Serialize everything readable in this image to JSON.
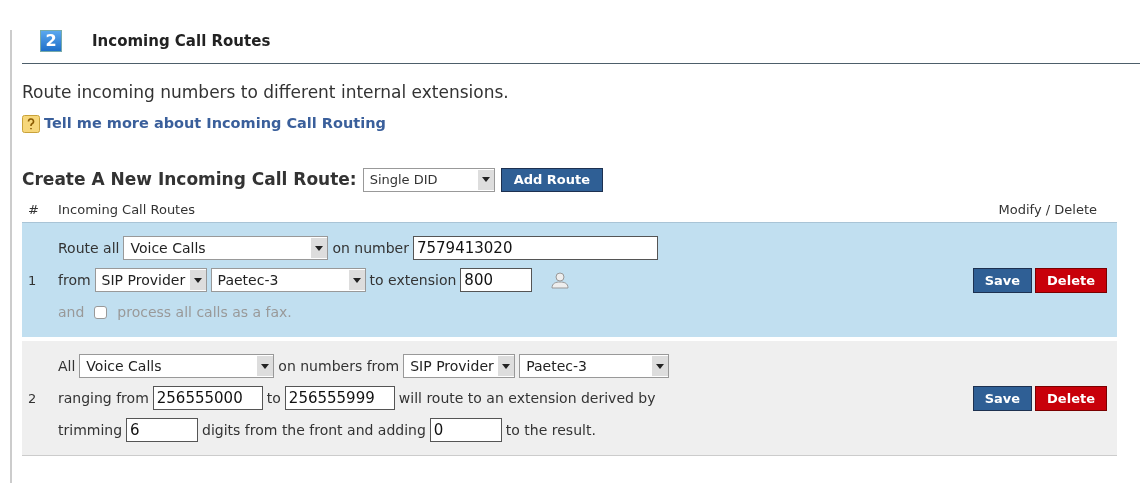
{
  "section": {
    "step": "2",
    "title": "Incoming Call Routes"
  },
  "description": "Route incoming numbers to different internal extensions.",
  "help_link": "Tell me more about Incoming Call Routing",
  "create": {
    "label": "Create A New Incoming Call Route:",
    "type_select": "Single DID",
    "button": "Add Route"
  },
  "table": {
    "columns": [
      "#",
      "Incoming Call Routes",
      "Modify / Delete"
    ],
    "rows": [
      {
        "number": "1",
        "selected": true,
        "lines": [
          {
            "disabled": false,
            "parts": [
              {
                "kind": "text",
                "text": "Route all"
              },
              {
                "kind": "select",
                "value": "Voice Calls"
              },
              {
                "kind": "text",
                "text": "on number"
              },
              {
                "kind": "input",
                "value": "7579413020"
              }
            ]
          },
          {
            "disabled": false,
            "parts": [
              {
                "kind": "text",
                "text": "from"
              },
              {
                "kind": "select",
                "value": "SIP Provider"
              },
              {
                "kind": "select",
                "value": "Paetec-3"
              },
              {
                "kind": "text",
                "text": "to extension"
              },
              {
                "kind": "input",
                "value": "800"
              },
              {
                "kind": "contact"
              }
            ]
          },
          {
            "disabled": true,
            "parts": [
              {
                "kind": "text",
                "text": "and"
              },
              {
                "kind": "checkbox",
                "checked": false
              },
              {
                "kind": "text",
                "text": "process all calls as a fax."
              }
            ]
          }
        ],
        "actions": [
          "Save",
          "Delete"
        ]
      },
      {
        "number": "2",
        "selected": false,
        "lines": [
          {
            "disabled": false,
            "parts": [
              {
                "kind": "text",
                "text": "All"
              },
              {
                "kind": "select",
                "value": "Voice Calls"
              },
              {
                "kind": "text",
                "text": "on numbers from"
              },
              {
                "kind": "select",
                "value": "SIP Provider"
              },
              {
                "kind": "select",
                "value": "Paetec-3"
              }
            ]
          },
          {
            "disabled": false,
            "parts": [
              {
                "kind": "text",
                "text": "ranging from"
              },
              {
                "kind": "input",
                "value": "256555000"
              },
              {
                "kind": "text",
                "text": "to"
              },
              {
                "kind": "input",
                "value": "256555999"
              },
              {
                "kind": "text",
                "text": "will route to an extension derived by"
              }
            ]
          },
          {
            "disabled": false,
            "parts": [
              {
                "kind": "text",
                "text": "trimming"
              },
              {
                "kind": "input",
                "value": "6"
              },
              {
                "kind": "text",
                "text": "digits from the front and adding"
              },
              {
                "kind": "input",
                "value": "0"
              },
              {
                "kind": "text",
                "text": "to the result."
              }
            ]
          }
        ],
        "actions": [
          "Save",
          "Delete"
        ]
      }
    ]
  }
}
